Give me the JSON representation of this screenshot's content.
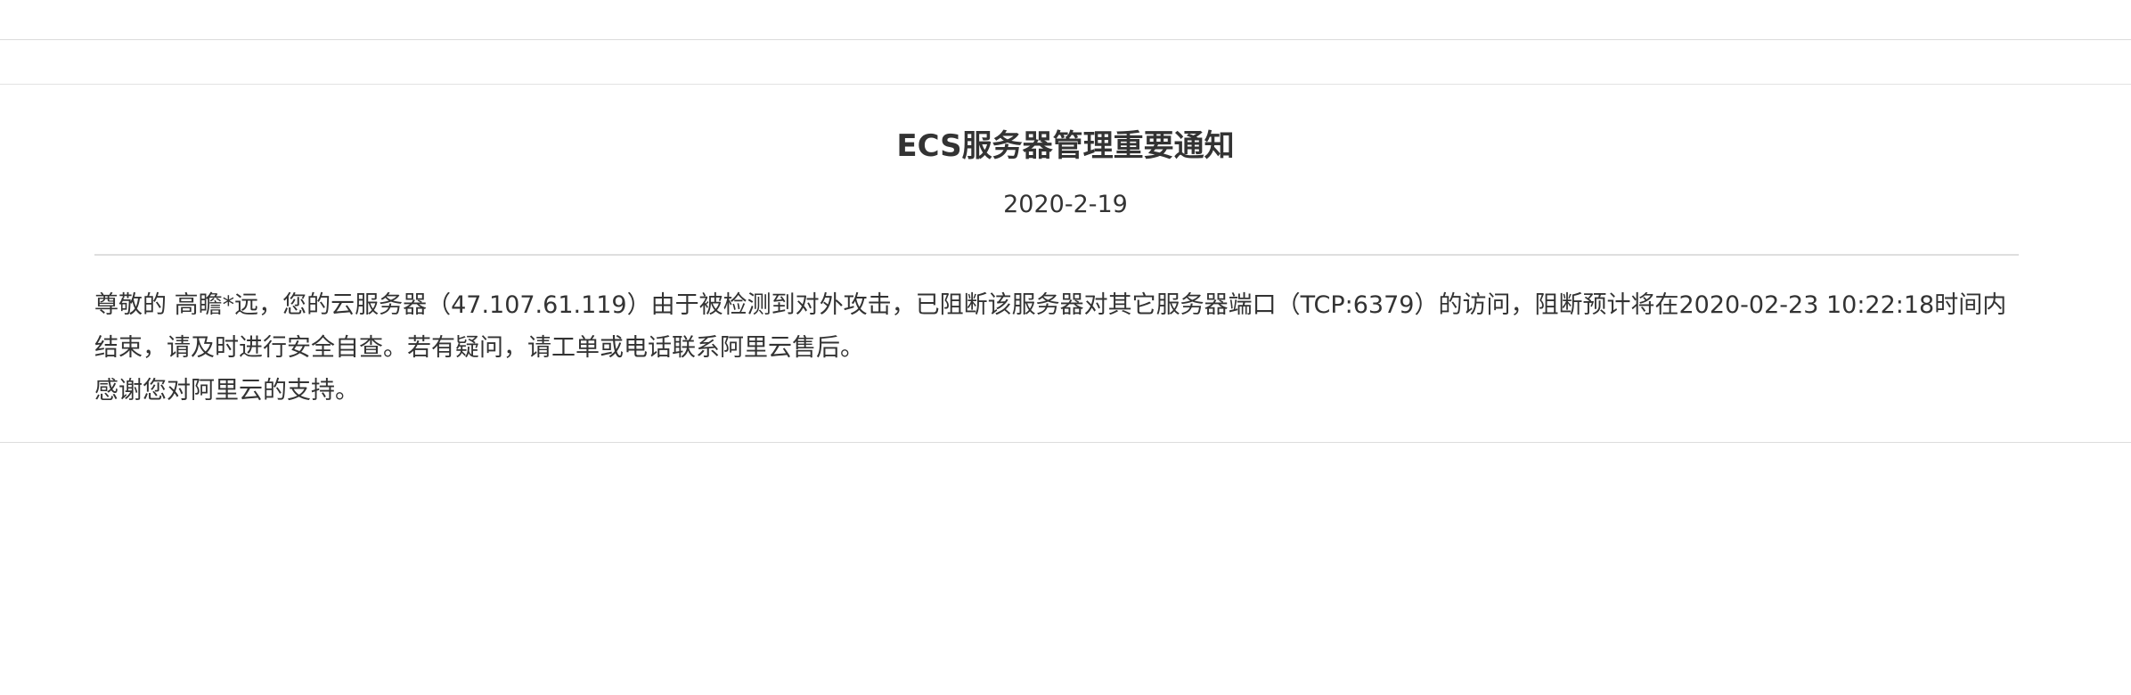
{
  "notice": {
    "title": "ECS服务器管理重要通知",
    "date": "2020-2-19",
    "paragraph_1": "尊敬的 高瞻*远，您的云服务器（47.107.61.119）由于被检测到对外攻击，已阻断该服务器对其它服务器端口（TCP:6379）的访问，阻断预计将在2020-02-23 10:22:18时间内结束，请及时进行安全自查。若有疑问，请工单或电话联系阿里云售后。",
    "paragraph_2": "感谢您对阿里云的支持。"
  }
}
